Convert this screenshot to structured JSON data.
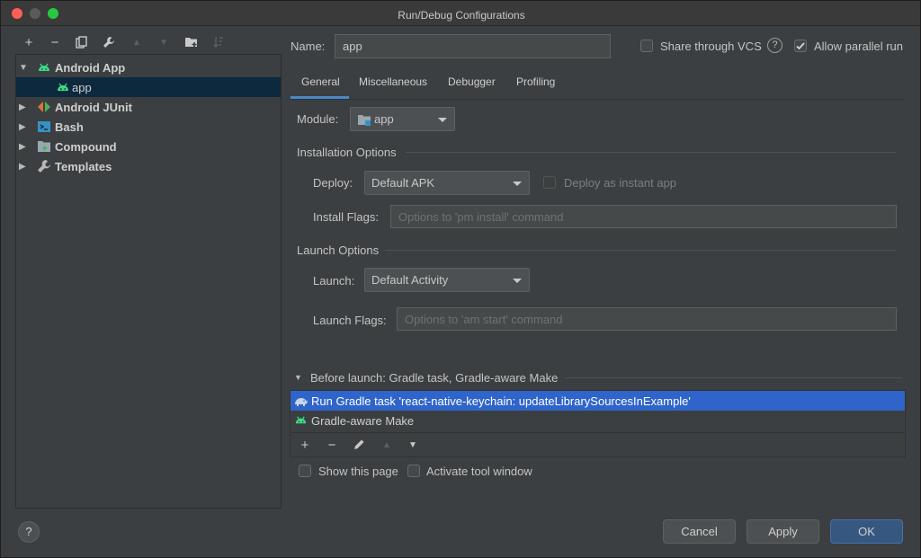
{
  "window": {
    "title": "Run/Debug Configurations"
  },
  "tree": {
    "items": [
      {
        "label": "Android App",
        "icon": "android-icon",
        "expanded": true
      },
      {
        "label": "app",
        "icon": "android-icon",
        "selected": true
      },
      {
        "label": "Android JUnit",
        "icon": "junit-icon"
      },
      {
        "label": "Bash",
        "icon": "terminal-icon"
      },
      {
        "label": "Compound",
        "icon": "compound-icon"
      },
      {
        "label": "Templates",
        "icon": "wrench-icon"
      }
    ]
  },
  "header": {
    "name_label": "Name:",
    "name_value": "app",
    "share_label": "Share through VCS",
    "share_checked": false,
    "parallel_label": "Allow parallel run",
    "parallel_checked": true
  },
  "tabs": [
    "General",
    "Miscellaneous",
    "Debugger",
    "Profiling"
  ],
  "active_tab": "General",
  "general": {
    "module_label": "Module:",
    "module_value": "app",
    "installation_section": "Installation Options",
    "deploy_label": "Deploy:",
    "deploy_value": "Default APK",
    "instant_app_label": "Deploy as instant app",
    "install_flags_label": "Install Flags:",
    "install_flags_placeholder": "Options to 'pm install' command",
    "launch_section": "Launch Options",
    "launch_label": "Launch:",
    "launch_value": "Default Activity",
    "launch_flags_label": "Launch Flags:",
    "launch_flags_placeholder": "Options to 'am start' command"
  },
  "before_launch": {
    "header": "Before launch: Gradle task, Gradle-aware Make",
    "tasks": [
      {
        "label": "Run Gradle task 'react-native-keychain: updateLibrarySourcesInExample'",
        "icon": "gradle-icon",
        "selected": true
      },
      {
        "label": "Gradle-aware Make",
        "icon": "android-icon",
        "selected": false
      }
    ],
    "show_page_label": "Show this page",
    "activate_window_label": "Activate tool window"
  },
  "footer": {
    "help": "?",
    "cancel": "Cancel",
    "apply": "Apply",
    "ok": "OK"
  },
  "colors": {
    "accent": "#4b6eaf",
    "selection": "#0d293e",
    "list_selection": "#2f65ca",
    "android_green": "#3ddc84"
  }
}
